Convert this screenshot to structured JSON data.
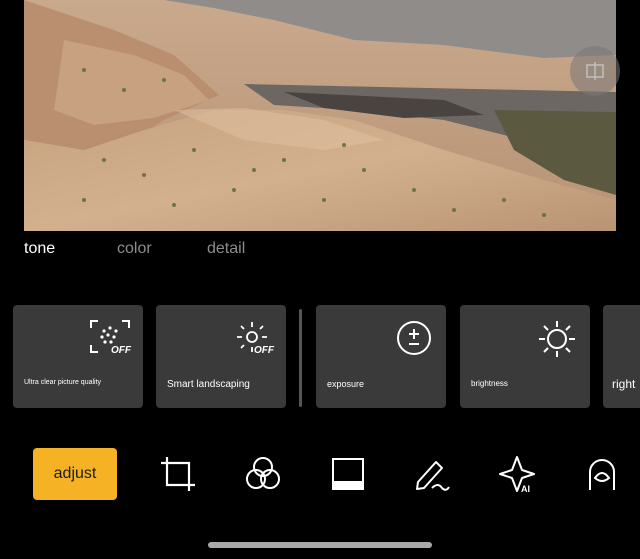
{
  "tabs": [
    "tone",
    "color",
    "detail"
  ],
  "active_tab": "tone",
  "cards": [
    {
      "label": "Ultra clear picture quality",
      "icon": "ultra-clear-off-icon",
      "badge": "OFF"
    },
    {
      "label": "Smart landscaping",
      "icon": "smart-landscaping-off-icon",
      "badge": "OFF"
    },
    {
      "label": "exposure",
      "icon": "exposure-icon"
    },
    {
      "label": "brightness",
      "icon": "brightness-icon"
    },
    {
      "label": "right",
      "icon": ""
    }
  ],
  "toolbar": {
    "adjust_label": "adjust",
    "tools": [
      "crop-icon",
      "filters-icon",
      "frame-icon",
      "markup-pen-icon",
      "ai-magic-icon",
      "portrait-icon"
    ]
  },
  "colors": {
    "accent": "#f5b225",
    "card_bg": "#3a3a3a",
    "inactive_tab": "#8c8c8c"
  }
}
